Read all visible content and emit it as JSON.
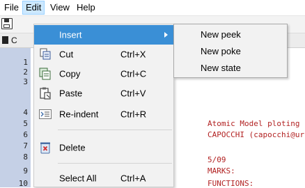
{
  "menubar": {
    "items": [
      {
        "label": "File"
      },
      {
        "label": "Edit"
      },
      {
        "label": "View"
      },
      {
        "label": "Help"
      }
    ]
  },
  "tabs": {
    "first_label": "C"
  },
  "gutter": {
    "line_numbers": [
      "1",
      "2",
      "3",
      "4",
      "5",
      "6",
      "7",
      "8",
      "9",
      "10"
    ]
  },
  "code": {
    "lines": [
      "Atomic Model ploting",
      "CAPOCCHI (capocchi@ur",
      "",
      "5/09",
      "MARKS:",
      "FUNCTIONS:"
    ]
  },
  "edit_menu": {
    "items": [
      {
        "label": "Insert",
        "shortcut": "",
        "icon": "none",
        "has_submenu": true
      },
      {
        "label": "Cut",
        "shortcut": "Ctrl+X",
        "icon": "cut-icon"
      },
      {
        "label": "Copy",
        "shortcut": "Ctrl+C",
        "icon": "copy-icon"
      },
      {
        "label": "Paste",
        "shortcut": "Ctrl+V",
        "icon": "paste-icon"
      },
      {
        "label": "Re-indent",
        "shortcut": "Ctrl+R",
        "icon": "reindent-icon"
      },
      {
        "label": "Delete",
        "shortcut": "",
        "icon": "delete-icon"
      },
      {
        "label": "Select All",
        "shortcut": "Ctrl+A",
        "icon": "none"
      }
    ]
  },
  "insert_submenu": {
    "items": [
      {
        "label": "New peek"
      },
      {
        "label": "New poke"
      },
      {
        "label": "New state"
      }
    ]
  },
  "colors": {
    "highlight": "#3a8fd6",
    "active_menu": "#cce8ff",
    "gutter": "#c5d0e6",
    "code_text": "#b22222"
  }
}
